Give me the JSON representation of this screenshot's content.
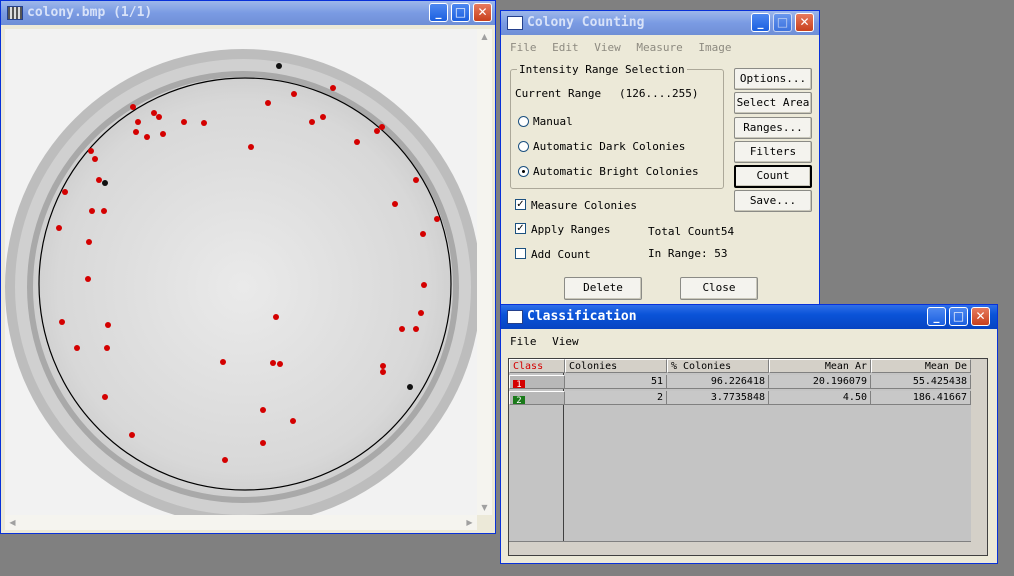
{
  "colony_window": {
    "title": "colony.bmp  (1/1)"
  },
  "counting_window": {
    "title": "Colony Counting",
    "menu": [
      "File",
      "Edit",
      "View",
      "Measure",
      "Image"
    ],
    "intensity_group": {
      "legend": "Intensity Range Selection",
      "current_range_label": "Current Range",
      "current_range_value": "(126....255)",
      "options": [
        {
          "label": "Manual",
          "selected": false
        },
        {
          "label": "Automatic Dark Colonies",
          "selected": false
        },
        {
          "label": "Automatic Bright Colonies",
          "selected": true
        }
      ]
    },
    "checkboxes": [
      {
        "label": "Measure Colonies",
        "checked": true
      },
      {
        "label": "Apply Ranges",
        "checked": true
      },
      {
        "label": "Add Count",
        "checked": false
      }
    ],
    "total_count": "Total Count54",
    "in_range": "In Range:  53",
    "side_buttons": [
      "Options...",
      "Select Area",
      "Ranges...",
      "Filters",
      "Count",
      "Save..."
    ],
    "delete_label": "Delete",
    "close_label": "Close"
  },
  "classification_window": {
    "title": "Classification",
    "menu": [
      "File",
      "View"
    ],
    "columns": [
      "Class",
      "Colonies",
      "% Colonies",
      "Mean Ar",
      "Mean De"
    ],
    "rows": [
      {
        "class": "1",
        "class_color": "#d40000",
        "colonies": "51",
        "percent": "96.226418",
        "mean_area": "20.196079",
        "mean_density": "55.425438"
      },
      {
        "class": "2",
        "class_color": "#1a7a1a",
        "colonies": "2",
        "percent": "3.7735848",
        "mean_area": "4.50",
        "mean_density": "186.41667"
      }
    ]
  },
  "colors": {
    "title_active": "#0a53d8",
    "window_face": "#ece9d8",
    "desktop": "#808080",
    "colony_marker": "#d40000"
  }
}
